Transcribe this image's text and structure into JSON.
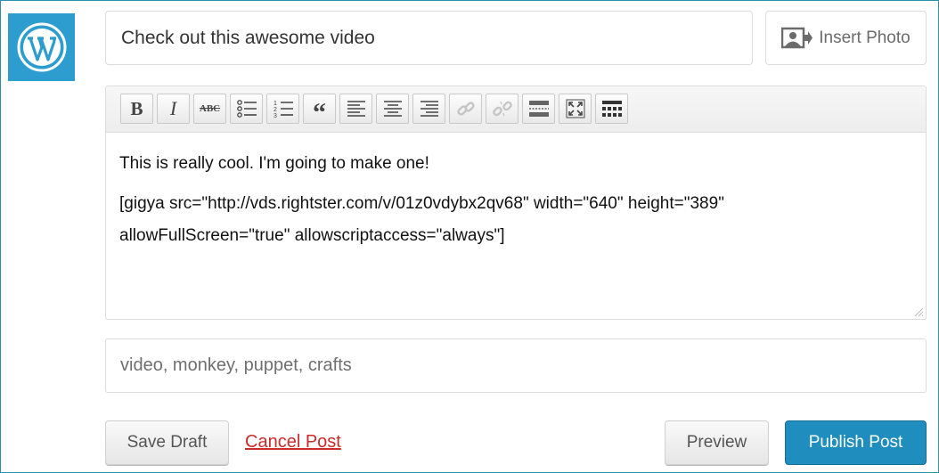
{
  "post": {
    "title": "Check out this awesome video",
    "content_line1": "This is really cool. I'm going to make one!",
    "content_line2": "[gigya src=\"http://vds.rightster.com/v/01z0vdybx2qv68\" width=\"640\" height=\"389\"",
    "content_line3": "allowFullScreen=\"true\" allowscriptaccess=\"always\"]",
    "tags": "video, monkey, puppet, crafts"
  },
  "header": {
    "insert_photo_label": "Insert Photo"
  },
  "toolbar": {
    "buttons": [
      {
        "name": "bold",
        "label": "B"
      },
      {
        "name": "italic",
        "label": "I"
      },
      {
        "name": "strikethrough",
        "label": "ABC"
      },
      {
        "name": "bulleted-list",
        "icon": "bulleted-list-icon"
      },
      {
        "name": "numbered-list",
        "icon": "numbered-list-icon"
      },
      {
        "name": "blockquote",
        "label": "“"
      },
      {
        "name": "align-left",
        "icon": "align-left-icon"
      },
      {
        "name": "align-center",
        "icon": "align-center-icon"
      },
      {
        "name": "align-right",
        "icon": "align-right-icon"
      },
      {
        "name": "insert-link",
        "icon": "link-icon",
        "disabled": true
      },
      {
        "name": "remove-link",
        "icon": "unlink-icon",
        "disabled": true
      },
      {
        "name": "insert-more",
        "icon": "more-tag-icon"
      },
      {
        "name": "fullscreen",
        "icon": "fullscreen-icon"
      },
      {
        "name": "kitchen-sink",
        "icon": "kitchen-sink-icon"
      }
    ]
  },
  "actions": {
    "save_draft": "Save Draft",
    "cancel": "Cancel Post",
    "preview": "Preview",
    "publish": "Publish Post"
  },
  "colors": {
    "brand": "#2d9ccf",
    "publish": "#1f8dbd",
    "cancel_link": "#cc2b2b",
    "frame_border": "#2a8eac"
  }
}
